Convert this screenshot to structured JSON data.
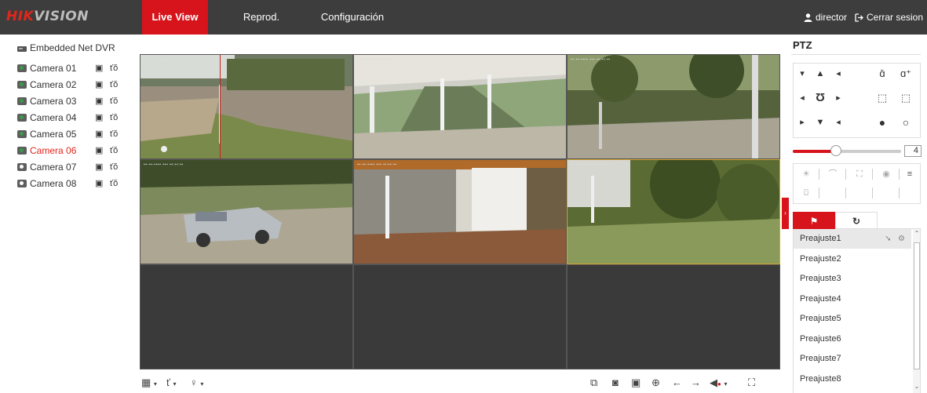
{
  "brand": {
    "hik": "HIK",
    "vision": "VISION",
    "color": "#d7131b"
  },
  "nav": [
    {
      "label": "Live View",
      "active": true
    },
    {
      "label": "Reprod.",
      "active": false
    },
    {
      "label": "Configuración",
      "active": false
    }
  ],
  "user": {
    "name": "director",
    "logout": "Cerrar sesion"
  },
  "device": {
    "name": "Embedded Net DVR"
  },
  "cameras": [
    {
      "name": "Camera 01",
      "online": true
    },
    {
      "name": "Camera 02",
      "online": true
    },
    {
      "name": "Camera 03",
      "online": true
    },
    {
      "name": "Camera 04",
      "online": true
    },
    {
      "name": "Camera 05",
      "online": true
    },
    {
      "name": "Camera 06",
      "online": true,
      "selected": true
    },
    {
      "name": "Camera 07",
      "online": false
    },
    {
      "name": "Camera 08",
      "online": false
    }
  ],
  "video_grid": {
    "layout": "3x3",
    "active_feeds": 6,
    "selected_window": 6
  },
  "toolbar": {
    "left_icons": [
      "layout-icon",
      "stream-icon",
      "microphone-icon"
    ],
    "right_icons": [
      "all-windows-icon",
      "capture-icon",
      "record-icon",
      "zoom-icon",
      "prev-page-icon",
      "next-page-icon",
      "volume-icon",
      "fullscreen-icon"
    ]
  },
  "ptz": {
    "title": "PTZ",
    "speed": "4",
    "speed_level": 0.4,
    "tabs": [
      "preset-tab",
      "patrol-tab"
    ],
    "presets": [
      "Preajuste1",
      "Preajuste2",
      "Preajuste3",
      "Preajuste4",
      "Preajuste5",
      "Preajuste6",
      "Preajuste7",
      "Preajuste8"
    ]
  }
}
